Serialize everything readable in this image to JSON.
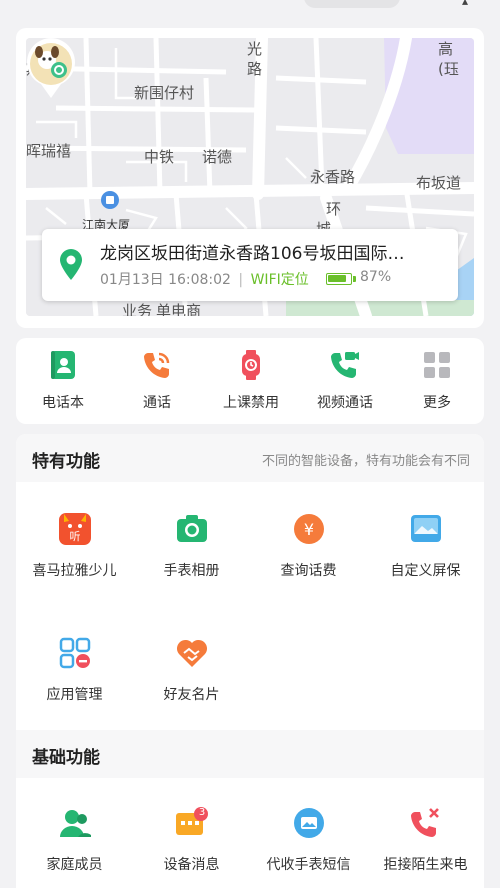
{
  "map": {
    "labels": [
      "期",
      "光",
      "路",
      "高",
      "(珏",
      "新围仔村",
      "晖瑞禧",
      "中铁",
      "诺德",
      "永香路",
      "布坂道",
      "江南大厦",
      "环",
      "城",
      "业务",
      "单电商"
    ]
  },
  "location": {
    "address": "龙岗区坂田街道永香路106号坂田国际…",
    "datetime": "01月13日 16:08:02",
    "separator": "|",
    "method": "WIFI定位",
    "battery_text": "87%",
    "battery_level": 0.87
  },
  "quick_actions": [
    {
      "label": "电话本",
      "icon": "phonebook-icon",
      "color": "#25b672"
    },
    {
      "label": "通话",
      "icon": "phone-call-icon",
      "color": "#f57b3b"
    },
    {
      "label": "上课禁用",
      "icon": "watch-lock-icon",
      "color": "#f0505d"
    },
    {
      "label": "视频通话",
      "icon": "video-call-icon",
      "color": "#25b672"
    },
    {
      "label": "更多",
      "icon": "more-grid-icon",
      "color": "#b8b8bc"
    }
  ],
  "special": {
    "title": "特有功能",
    "note": "不同的智能设备，特有功能会有不同",
    "items": [
      {
        "label": "喜马拉雅少儿",
        "icon": "ximalaya-icon"
      },
      {
        "label": "手表相册",
        "icon": "camera-icon"
      },
      {
        "label": "查询话费",
        "icon": "yuan-coin-icon"
      },
      {
        "label": "自定义屏保",
        "icon": "wallpaper-icon"
      },
      {
        "label": "应用管理",
        "icon": "app-manage-icon"
      },
      {
        "label": "好友名片",
        "icon": "handshake-heart-icon"
      }
    ]
  },
  "basic": {
    "title": "基础功能",
    "items": [
      {
        "label": "家庭成员",
        "icon": "family-icon"
      },
      {
        "label": "设备消息",
        "icon": "device-message-icon",
        "badge": "3"
      },
      {
        "label": "代收手表短信",
        "icon": "sms-icon"
      },
      {
        "label": "拒接陌生来电",
        "icon": "reject-call-icon"
      }
    ]
  },
  "colors": {
    "green": "#25b672",
    "orange": "#f57b3b",
    "red": "#f0505d",
    "wifi_green": "#6abf2a",
    "blue": "#42a9e8"
  }
}
